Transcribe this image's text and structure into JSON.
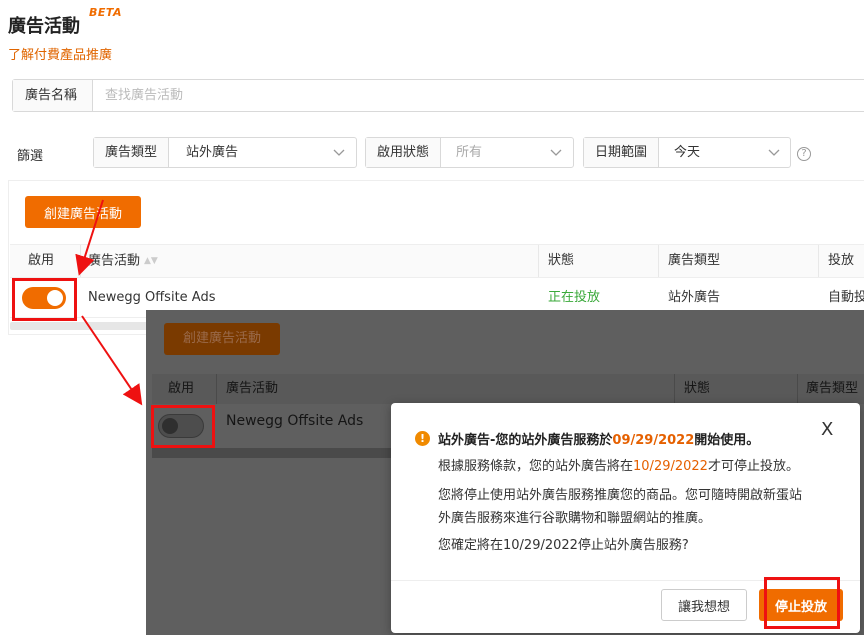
{
  "header": {
    "title": "廣告活動",
    "badge": "BETA",
    "learn_link": "了解付費產品推廣"
  },
  "search": {
    "label": "廣告名稱",
    "placeholder": "查找廣告活動"
  },
  "filters": {
    "label": "篩選",
    "ad_type": {
      "label": "廣告類型",
      "value": "站外廣告"
    },
    "status": {
      "label": "啟用狀態",
      "value": "所有"
    },
    "date_range": {
      "label": "日期範圍",
      "value": "今天"
    },
    "help_icon": "?"
  },
  "toolbar": {
    "create_label": "創建廣告活動"
  },
  "table": {
    "columns": [
      "啟用",
      "廣告活動",
      "狀態",
      "廣告類型",
      "投放"
    ],
    "rows": [
      {
        "enabled": true,
        "campaign": "Newegg Offsite Ads",
        "status": "正在投放",
        "ad_type": "站外廣告",
        "delivery": "自動投"
      }
    ]
  },
  "overlay": {
    "create_label": "創建廣告活動",
    "columns": [
      "啟用",
      "廣告活動",
      "狀態",
      "廣告類型"
    ],
    "row": {
      "enabled": false,
      "campaign": "Newegg Offsite Ads"
    }
  },
  "modal": {
    "title_prefix": "站外廣告-您的站外廣告服務於",
    "title_date": "09/29/2022",
    "title_suffix": "開始使用。",
    "line1_prefix": "根據服務條款，您的站外廣告將在",
    "line1_date": "10/29/2022",
    "line1_suffix": "才可停止投放。",
    "line2a": "您將停止使用站外廣告服務推廣您的商品。您可隨時開啟新蛋站",
    "line2b": "外廣告服務來進行谷歌購物和聯盟網站的推廣。",
    "line3": "您確定將在10/29/2022停止站外廣告服務?",
    "cancel_label": "讓我想想",
    "confirm_label": "停止投放",
    "close_icon": "X"
  },
  "colors": {
    "accent": "#f06c00",
    "status_active": "#3aa93a",
    "highlight_box": "#e11111"
  }
}
